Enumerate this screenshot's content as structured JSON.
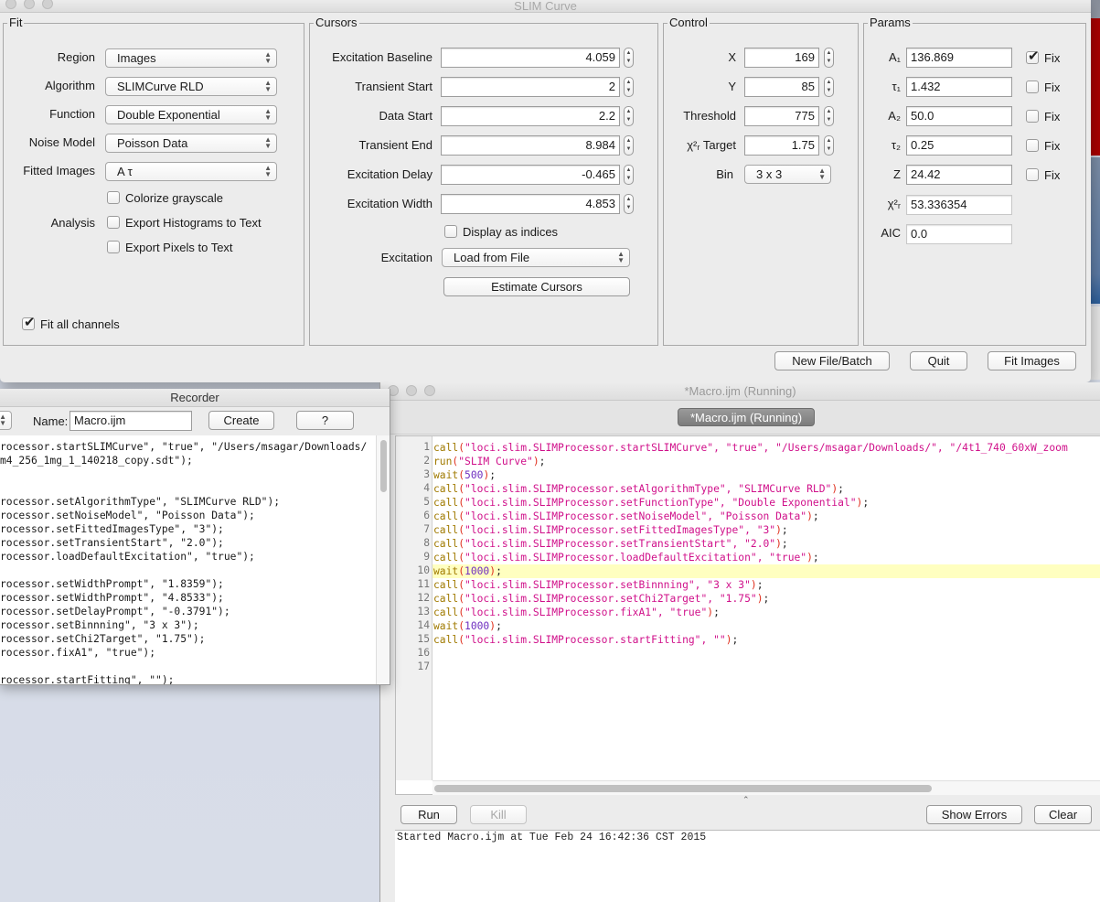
{
  "slim_window": {
    "title": "SLIM Curve",
    "fit": {
      "title": "Fit",
      "region": {
        "label": "Region",
        "value": "Images"
      },
      "algorithm": {
        "label": "Algorithm",
        "value": "SLIMCurve RLD"
      },
      "function": {
        "label": "Function",
        "value": "Double Exponential"
      },
      "noise_model": {
        "label": "Noise Model",
        "value": "Poisson Data"
      },
      "fitted_images": {
        "label": "Fitted Images",
        "value": "A τ"
      },
      "analysis_label": "Analysis",
      "colorize": {
        "label": "Colorize grayscale",
        "checked": false
      },
      "export_histograms": {
        "label": "Export Histograms to Text",
        "checked": false
      },
      "export_pixels": {
        "label": "Export Pixels to Text",
        "checked": false
      },
      "fit_all_channels": {
        "label": "Fit all channels",
        "checked": true
      }
    },
    "cursors": {
      "title": "Cursors",
      "rows": [
        {
          "label": "Excitation Baseline",
          "value": "4.059"
        },
        {
          "label": "Transient Start",
          "value": "2"
        },
        {
          "label": "Data Start",
          "value": "2.2"
        },
        {
          "label": "Transient End",
          "value": "8.984"
        },
        {
          "label": "Excitation Delay",
          "value": "-0.465"
        },
        {
          "label": "Excitation Width",
          "value": "4.853"
        }
      ],
      "display_indices": {
        "label": "Display as indices",
        "checked": false
      },
      "excitation": {
        "label": "Excitation",
        "value": "Load from File"
      },
      "estimate_button": "Estimate Cursors"
    },
    "control": {
      "title": "Control",
      "rows": [
        {
          "label": "X",
          "value": "169"
        },
        {
          "label": "Y",
          "value": "85"
        },
        {
          "label": "Threshold",
          "value": "775"
        },
        {
          "label": "χ²ᵣ Target",
          "value": "1.75"
        }
      ],
      "bin": {
        "label": "Bin",
        "value": "3 x 3"
      }
    },
    "params": {
      "title": "Params",
      "fix_label": "Fix",
      "rows": [
        {
          "label": "A₁",
          "value": "136.869",
          "fixed": true
        },
        {
          "label": "τ₁",
          "value": "1.432",
          "fixed": false
        },
        {
          "label": "A₂",
          "value": "50.0",
          "fixed": false
        },
        {
          "label": "τ₂",
          "value": "0.25",
          "fixed": false
        },
        {
          "label": "Z",
          "value": "24.42",
          "fixed": false
        }
      ],
      "chi2": {
        "label": "χ²ᵣ",
        "value": "53.336354"
      },
      "aic": {
        "label": "AIC",
        "value": "0.0"
      }
    },
    "buttons": {
      "new_file": "New File/Batch",
      "quit": "Quit",
      "fit_images": "Fit Images"
    }
  },
  "recorder": {
    "title": "Recorder",
    "name_label": "Name:",
    "name_value": "Macro.ijm",
    "create_button": "Create",
    "help_button": "?",
    "lines": [
      "rocessor.startSLIMCurve\", \"true\", \"/Users/msagar/Downloads/",
      "m4_256_1mg_1_140218_copy.sdt\");",
      "",
      "",
      "rocessor.setAlgorithmType\", \"SLIMCurve RLD\");",
      "rocessor.setNoiseModel\", \"Poisson Data\");",
      "rocessor.setFittedImagesType\", \"3\");",
      "rocessor.setTransientStart\", \"2.0\");",
      "rocessor.loadDefaultExcitation\", \"true\");",
      "",
      "rocessor.setWidthPrompt\", \"1.8359\");",
      "rocessor.setWidthPrompt\", \"4.8533\");",
      "rocessor.setDelayPrompt\", \"-0.3791\");",
      "rocessor.setBinnning\", \"3 x 3\");",
      "rocessor.setChi2Target\", \"1.75\");",
      "rocessor.fixA1\", \"true\");",
      "",
      "rocessor.startFitting\", \"\");"
    ]
  },
  "macro_editor": {
    "title": "*Macro.ijm (Running)",
    "tab": "*Macro.ijm (Running)",
    "highlighted_line": 10,
    "code_lines": [
      [
        {
          "t": "call",
          "c": "k-call"
        },
        {
          "t": "(",
          "c": "k-par"
        },
        {
          "t": "\"loci.slim.SLIMProcessor.startSLIMCurve\", \"true\", \"/Users/msagar/Downloads/\", \"/4t1_740_60xW_zoom",
          "c": "k-str"
        }
      ],
      [
        {
          "t": "run",
          "c": "k-call"
        },
        {
          "t": "(",
          "c": "k-par"
        },
        {
          "t": "\"SLIM Curve\"",
          "c": "k-str"
        },
        {
          "t": ")",
          "c": "k-par"
        },
        {
          "t": ";",
          "c": "k-plain"
        }
      ],
      [
        {
          "t": "wait",
          "c": "k-call"
        },
        {
          "t": "(",
          "c": "k-par"
        },
        {
          "t": "500",
          "c": "k-num"
        },
        {
          "t": ")",
          "c": "k-par"
        },
        {
          "t": ";",
          "c": "k-plain"
        }
      ],
      [
        {
          "t": "call",
          "c": "k-call"
        },
        {
          "t": "(",
          "c": "k-par"
        },
        {
          "t": "\"loci.slim.SLIMProcessor.setAlgorithmType\", \"SLIMCurve RLD\"",
          "c": "k-str"
        },
        {
          "t": ")",
          "c": "k-par"
        },
        {
          "t": ";",
          "c": "k-plain"
        }
      ],
      [
        {
          "t": "call",
          "c": "k-call"
        },
        {
          "t": "(",
          "c": "k-par"
        },
        {
          "t": "\"loci.slim.SLIMProcessor.setFunctionType\", \"Double Exponential\"",
          "c": "k-str"
        },
        {
          "t": ")",
          "c": "k-par"
        },
        {
          "t": ";",
          "c": "k-plain"
        }
      ],
      [
        {
          "t": "call",
          "c": "k-call"
        },
        {
          "t": "(",
          "c": "k-par"
        },
        {
          "t": "\"loci.slim.SLIMProcessor.setNoiseModel\", \"Poisson Data\"",
          "c": "k-str"
        },
        {
          "t": ")",
          "c": "k-par"
        },
        {
          "t": ";",
          "c": "k-plain"
        }
      ],
      [
        {
          "t": "call",
          "c": "k-call"
        },
        {
          "t": "(",
          "c": "k-par"
        },
        {
          "t": "\"loci.slim.SLIMProcessor.setFittedImagesType\", \"3\"",
          "c": "k-str"
        },
        {
          "t": ")",
          "c": "k-par"
        },
        {
          "t": ";",
          "c": "k-plain"
        }
      ],
      [
        {
          "t": "call",
          "c": "k-call"
        },
        {
          "t": "(",
          "c": "k-par"
        },
        {
          "t": "\"loci.slim.SLIMProcessor.setTransientStart\", \"2.0\"",
          "c": "k-str"
        },
        {
          "t": ")",
          "c": "k-par"
        },
        {
          "t": ";",
          "c": "k-plain"
        }
      ],
      [
        {
          "t": "call",
          "c": "k-call"
        },
        {
          "t": "(",
          "c": "k-par"
        },
        {
          "t": "\"loci.slim.SLIMProcessor.loadDefaultExcitation\", \"true\"",
          "c": "k-str"
        },
        {
          "t": ")",
          "c": "k-par"
        },
        {
          "t": ";",
          "c": "k-plain"
        }
      ],
      [
        {
          "t": "wait",
          "c": "k-call"
        },
        {
          "t": "(",
          "c": "k-par"
        },
        {
          "t": "1000",
          "c": "k-num"
        },
        {
          "t": ")",
          "c": "k-par"
        },
        {
          "t": ";",
          "c": "k-plain"
        }
      ],
      [
        {
          "t": "call",
          "c": "k-call"
        },
        {
          "t": "(",
          "c": "k-par"
        },
        {
          "t": "\"loci.slim.SLIMProcessor.setBinnning\", \"3 x 3\"",
          "c": "k-str"
        },
        {
          "t": ")",
          "c": "k-par"
        },
        {
          "t": ";",
          "c": "k-plain"
        }
      ],
      [
        {
          "t": "call",
          "c": "k-call"
        },
        {
          "t": "(",
          "c": "k-par"
        },
        {
          "t": "\"loci.slim.SLIMProcessor.setChi2Target\", \"1.75\"",
          "c": "k-str"
        },
        {
          "t": ")",
          "c": "k-par"
        },
        {
          "t": ";",
          "c": "k-plain"
        }
      ],
      [
        {
          "t": "call",
          "c": "k-call"
        },
        {
          "t": "(",
          "c": "k-par"
        },
        {
          "t": "\"loci.slim.SLIMProcessor.fixA1\", \"true\"",
          "c": "k-str"
        },
        {
          "t": ")",
          "c": "k-par"
        },
        {
          "t": ";",
          "c": "k-plain"
        }
      ],
      [
        {
          "t": "wait",
          "c": "k-call"
        },
        {
          "t": "(",
          "c": "k-par"
        },
        {
          "t": "1000",
          "c": "k-num"
        },
        {
          "t": ")",
          "c": "k-par"
        },
        {
          "t": ";",
          "c": "k-plain"
        }
      ],
      [
        {
          "t": "call",
          "c": "k-call"
        },
        {
          "t": "(",
          "c": "k-par"
        },
        {
          "t": "\"loci.slim.SLIMProcessor.startFitting\", \"\"",
          "c": "k-str"
        },
        {
          "t": ")",
          "c": "k-par"
        },
        {
          "t": ";",
          "c": "k-plain"
        }
      ],
      [],
      []
    ],
    "buttons": {
      "run": "Run",
      "kill": "Kill",
      "show_errors": "Show Errors",
      "clear": "Clear"
    },
    "log": "Started Macro.ijm at Tue Feb 24 16:42:36 CST 2015"
  }
}
